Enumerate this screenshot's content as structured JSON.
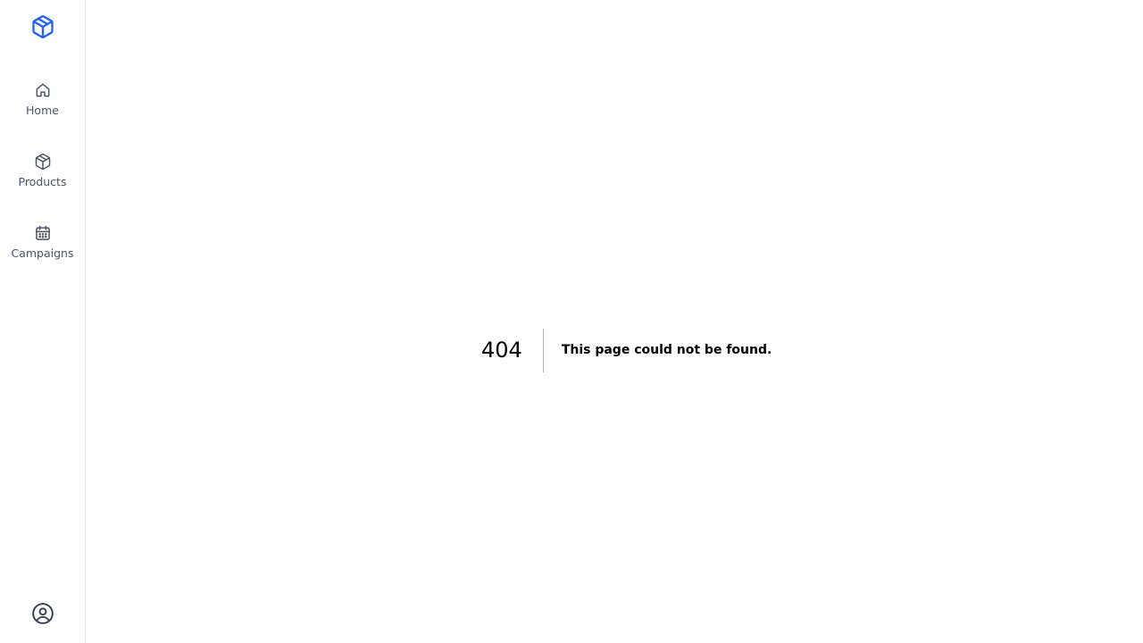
{
  "colors": {
    "brand": "#2563eb",
    "nav_text": "#4b5563",
    "nav_icon": "#4b5563",
    "sidebar_border": "#e5e7eb"
  },
  "sidebar": {
    "logo_icon": "cube-icon",
    "items": [
      {
        "label": "Home",
        "icon": "home-icon"
      },
      {
        "label": "Products",
        "icon": "package-icon"
      },
      {
        "label": "Campaigns",
        "icon": "calendar-icon"
      }
    ],
    "account_icon": "user-circle-icon"
  },
  "error": {
    "code": "404",
    "message": "This page could not be found."
  }
}
